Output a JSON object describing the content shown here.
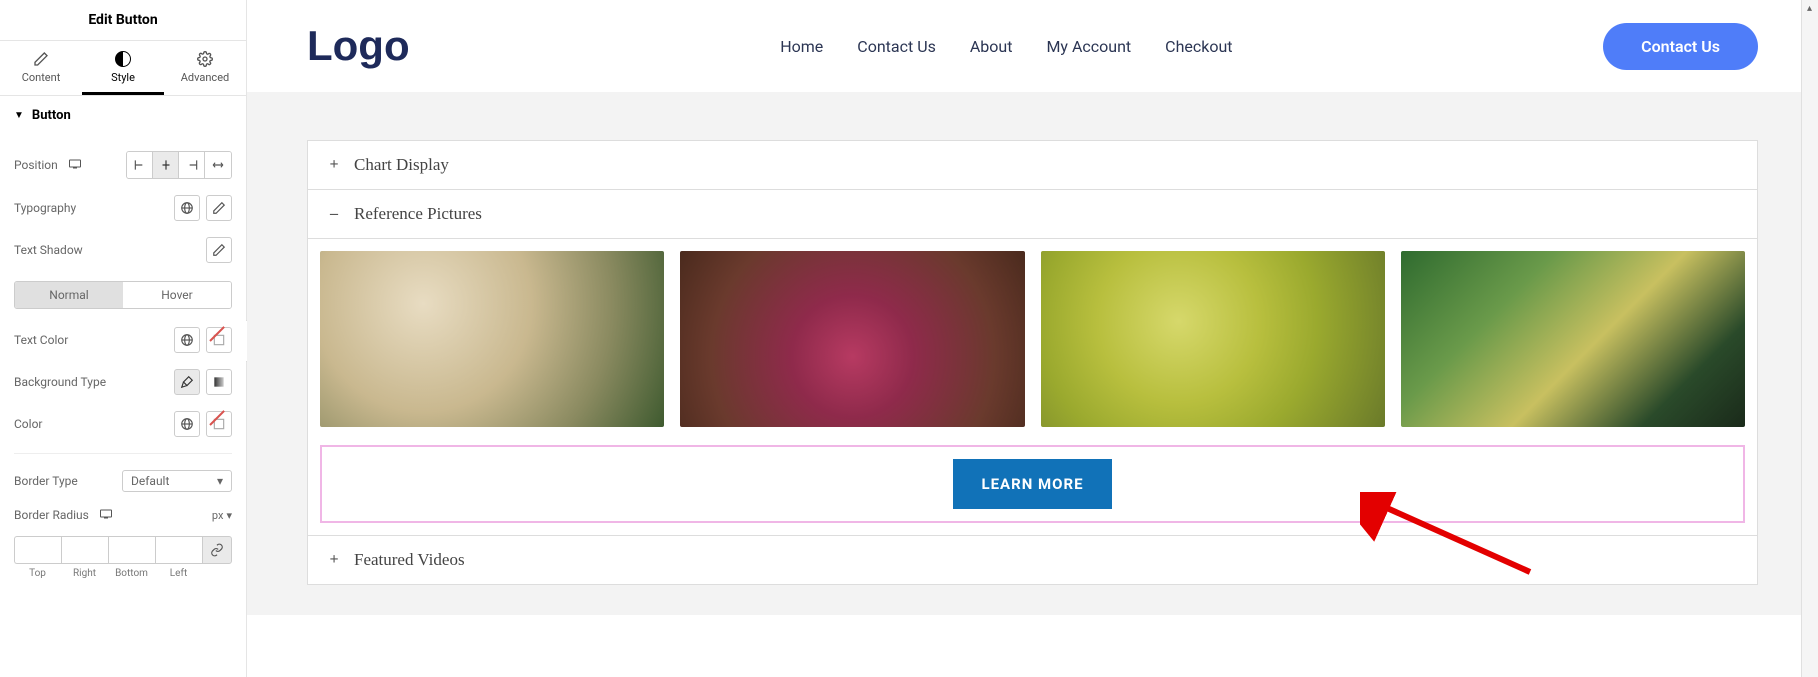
{
  "sidebar": {
    "title": "Edit Button",
    "tabs": {
      "content": "Content",
      "style": "Style",
      "advanced": "Advanced"
    },
    "section": {
      "button": "Button"
    },
    "controls": {
      "position": "Position",
      "typography": "Typography",
      "text_shadow": "Text Shadow",
      "text_color": "Text Color",
      "background_type": "Background Type",
      "color": "Color",
      "border_type": "Border Type",
      "border_type_value": "Default",
      "border_radius": "Border Radius",
      "unit": "px",
      "normal": "Normal",
      "hover": "Hover",
      "radius_labels": {
        "top": "Top",
        "right": "Right",
        "bottom": "Bottom",
        "left": "Left"
      }
    }
  },
  "preview": {
    "logo": "Logo",
    "nav": {
      "home": "Home",
      "contact_us": "Contact Us",
      "about": "About",
      "my_account": "My Account",
      "checkout": "Checkout"
    },
    "cta": "Contact Us",
    "accordion": {
      "chart_display": "Chart Display",
      "reference_pictures": "Reference Pictures",
      "featured_videos": "Featured Videos"
    },
    "learn_more": "LEARN MORE"
  }
}
